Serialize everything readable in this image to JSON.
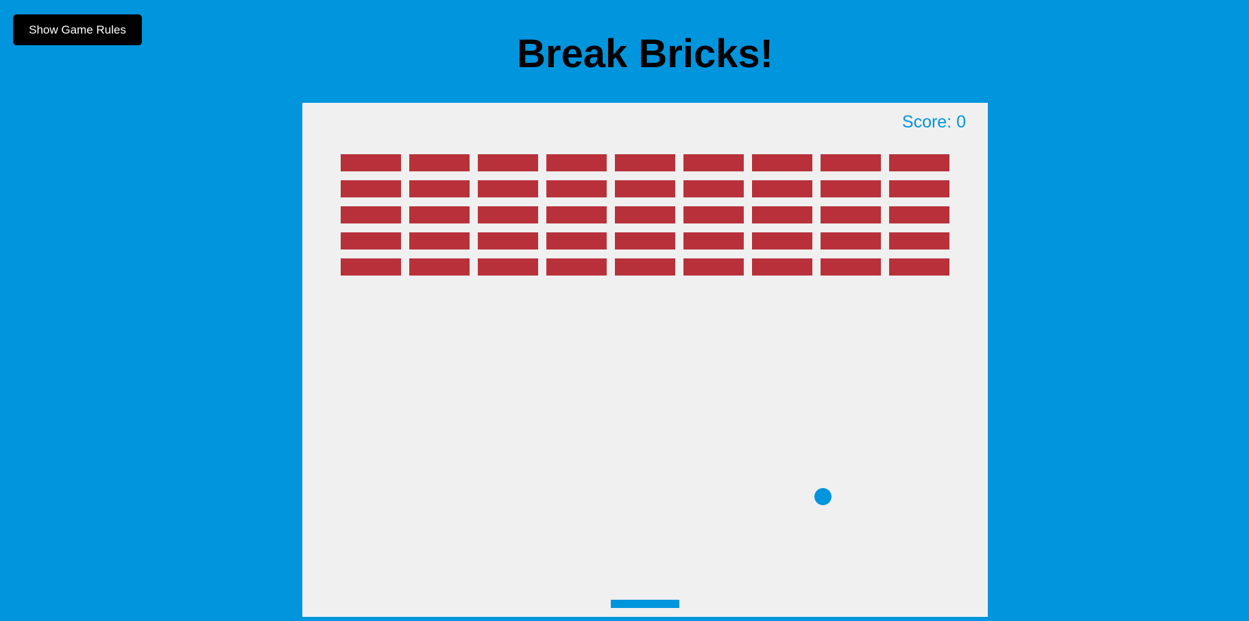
{
  "colors": {
    "background": "#0095dd",
    "canvas": "#f0f0f0",
    "brick": "#b8313a",
    "accent": "#0095dd",
    "button": "#000000",
    "button_text": "#ffffff"
  },
  "rules_button": {
    "label": "Show Game Rules"
  },
  "title": "Break Bricks!",
  "game": {
    "score_label": "Score: 0",
    "score": 0,
    "bricks": {
      "rows": 5,
      "columns": 9
    }
  }
}
